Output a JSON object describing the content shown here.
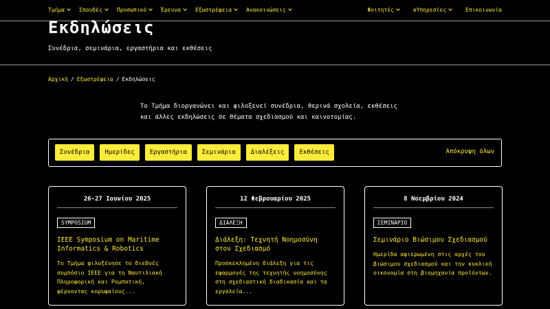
{
  "nav": {
    "left": [
      {
        "label": "Τμήμα",
        "chevron": true
      },
      {
        "label": "Σπουδές",
        "chevron": true
      },
      {
        "label": "Προσωπικό",
        "chevron": true
      },
      {
        "label": "Έρευνα",
        "chevron": true
      },
      {
        "label": "Εξωστρέφεια",
        "chevron": true
      },
      {
        "label": "Ανακοινώσεις",
        "chevron": true
      }
    ],
    "right": [
      {
        "label": "Φοιτητές",
        "chevron": true
      },
      {
        "label": "eΥπηρεσίες",
        "chevron": true
      },
      {
        "label": "Επικοινωνία",
        "chevron": false
      }
    ]
  },
  "hero": {
    "title": "Εκδηλώσεις",
    "subtitle": "Συνέδρια, σεμινάρια, εργαστήρια και εκθέσεις"
  },
  "breadcrumb": {
    "items": [
      "Αρχική",
      "Εξωστρέφεια"
    ],
    "separator": "/",
    "current": "Εκδηλώσεις"
  },
  "intro": {
    "line1": "Το Τμήμα διοργανώνει και φιλοξενεί συνέδρια, θερινά σχολεία, εκθέσεις",
    "line2": "και άλλες εκδηλώσεις σε θέματα σχεδιασμού και καινοτομίας."
  },
  "filters": {
    "chips": [
      "Συνέδρια",
      "Ημερίδες",
      "Εργαστήρια",
      "Σεμινάρια",
      "Διαλέξεις",
      "Εκθέσεις"
    ],
    "hide_all": "Απόκρυψη όλων"
  },
  "events": [
    {
      "date": "26-27 Ιουνίου 2025",
      "badge": "SYMPOSIUM",
      "title": "IEEE Symposium on Maritime Informatics & Robotics",
      "text": "Το Τμήμα φιλοξένησε το διεθνές συμπόσιο IEEE για τη Ναυτιλιακή Πληροφορική και Ρομποτική, φέρνοντας κορυφαίους..."
    },
    {
      "date": "12 Φεβρουαρίου 2025",
      "badge": "ΔΙΑΛΕΞΗ",
      "title": "Διάλεξη: Τεχνητή Νοημοσύνη στον Σχεδιασμό",
      "text": "Προσκεκλημένη διάλεξη για τις εφαρμογές της τεχνητής νοημοσύνης στη σχεδιαστική διαδικασία και τα εργαλεία..."
    },
    {
      "date": "8 Νοεμβρίου 2024",
      "badge": "ΣΕΜΙΝΑΡΙΟ",
      "title": "Σεμινάριο Βιώσιμου Σχεδιασμού",
      "text": "Ημερίδα αφιερωμένη στις αρχές του βιώσιμου σχεδιασμού και την κυκλική οικονομία στη βιομηχανία προϊόντων."
    }
  ],
  "colors": {
    "accent": "#ffeb3b",
    "background": "#000000",
    "text": "#ffffff"
  }
}
